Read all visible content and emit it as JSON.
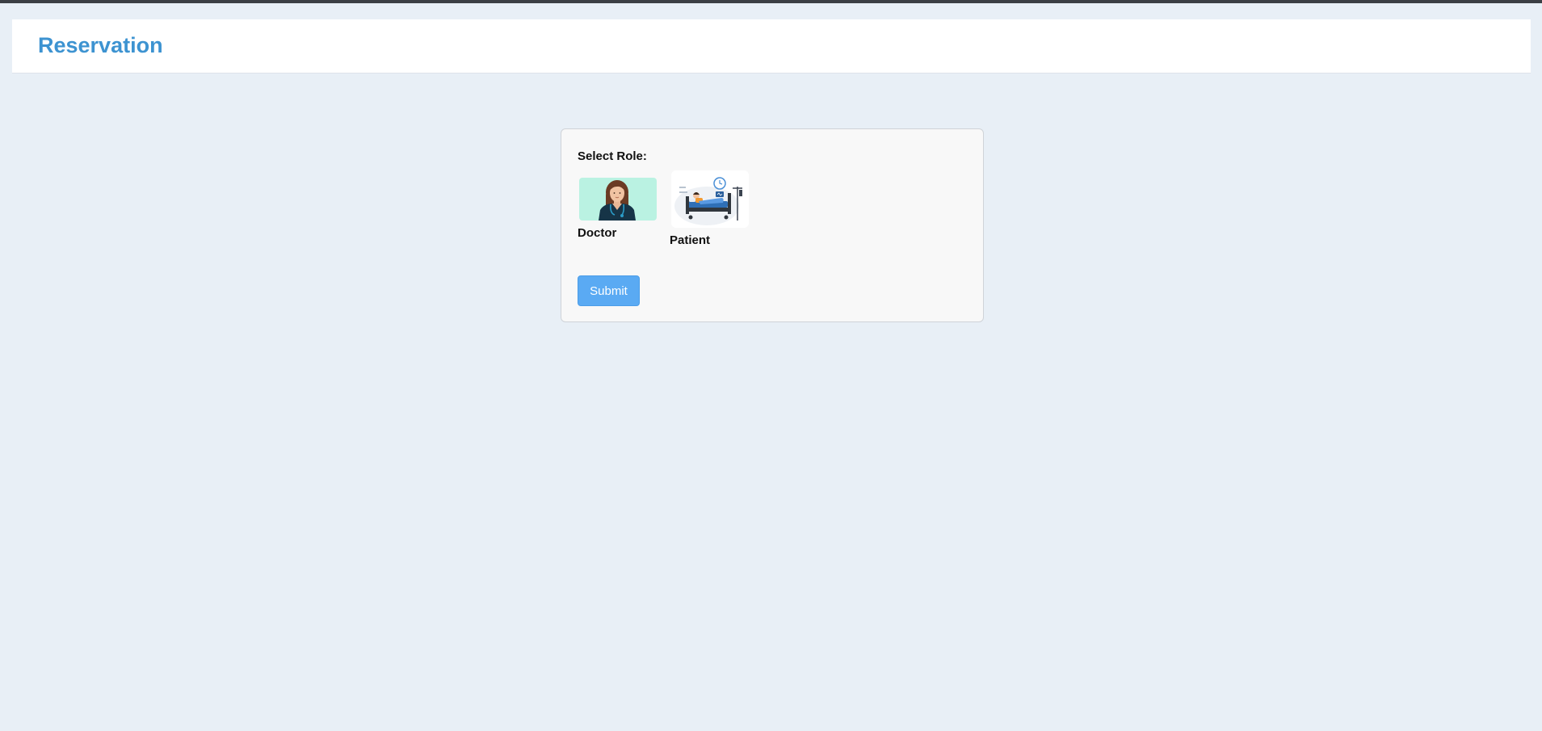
{
  "header": {
    "title": "Reservation"
  },
  "form": {
    "label": "Select Role:",
    "roles": [
      {
        "name": "Doctor",
        "icon": "doctor-illustration-icon"
      },
      {
        "name": "Patient",
        "icon": "patient-hospital-bed-illustration-icon"
      }
    ],
    "submit_label": "Submit"
  },
  "colors": {
    "background": "#e8eff6",
    "title": "#3d93d1",
    "button": "#5aaaf3",
    "doctor_tile": "#baf2e2"
  }
}
